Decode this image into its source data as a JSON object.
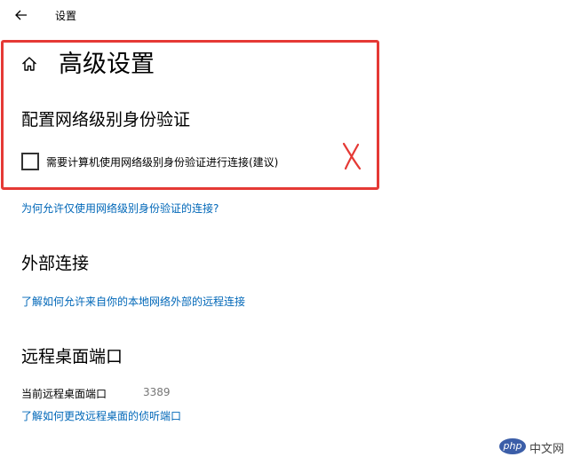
{
  "window": {
    "title": "设置",
    "back_icon": "arrow-left-icon"
  },
  "header": {
    "home_icon": "home-icon",
    "title": "高级设置"
  },
  "nla_section": {
    "heading": "配置网络级别身份验证",
    "checkbox_label": "需要计算机使用网络级别身份验证进行连接(建议)",
    "checkbox_checked": false,
    "help_link": "为何允许仅使用网络级别身份验证的连接?"
  },
  "external_section": {
    "heading": "外部连接",
    "help_link": "了解如何允许来自你的本地网络外部的远程连接"
  },
  "port_section": {
    "heading": "远程桌面端口",
    "port_label": "当前远程桌面端口",
    "port_value": "3389",
    "help_link": "了解如何更改远程桌面的侦听端口"
  },
  "annotation": {
    "mark_text": "X",
    "color": "#e53935"
  },
  "watermark": {
    "logo_text": "php",
    "site_text": "中文网"
  },
  "colors": {
    "link": "#0067b8",
    "text": "#000000",
    "muted": "#767676"
  }
}
